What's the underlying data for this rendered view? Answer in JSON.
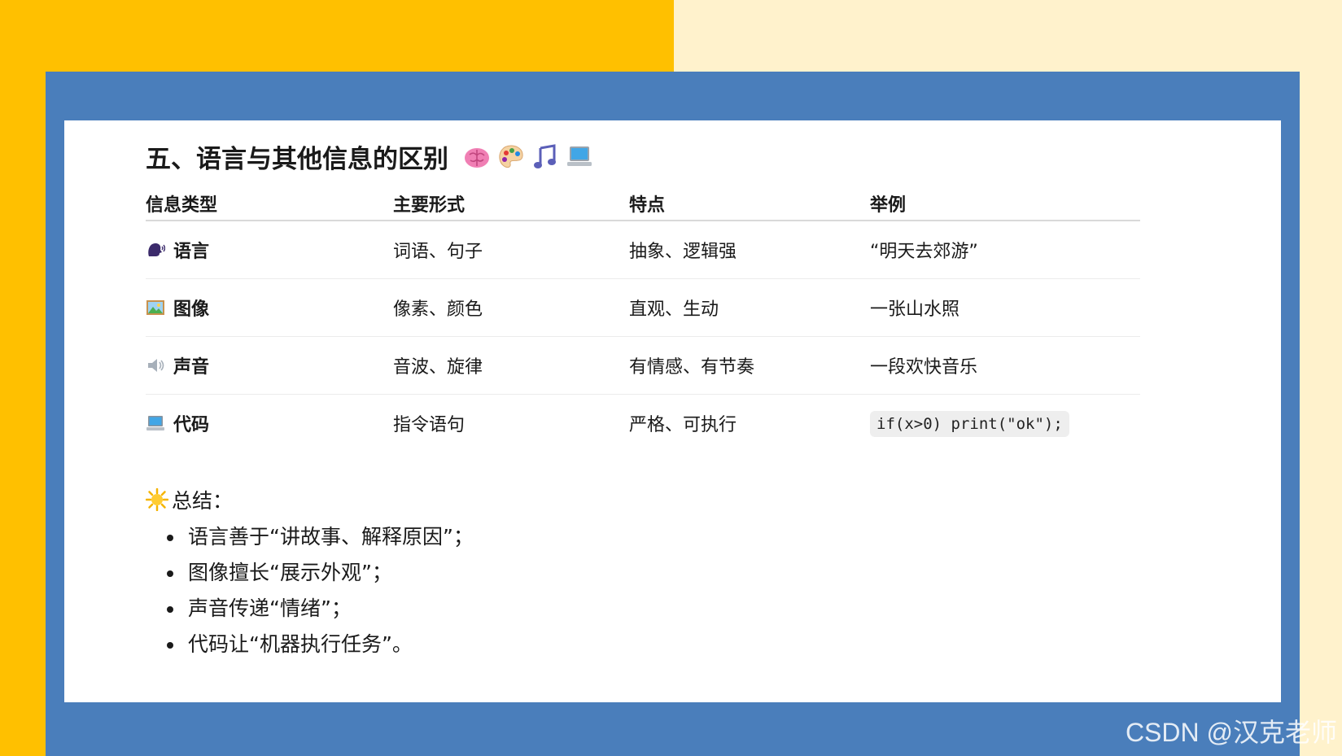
{
  "title": "五、语言与其他信息的区别",
  "title_icons": [
    "brain-icon",
    "palette-icon",
    "music-note-icon",
    "laptop-icon"
  ],
  "table": {
    "headers": [
      "信息类型",
      "主要形式",
      "特点",
      "举例"
    ],
    "rows": [
      {
        "icon": "speaking-head-icon",
        "type": "语言",
        "form": "词语、句子",
        "trait": "抽象、逻辑强",
        "example": "“明天去郊游”"
      },
      {
        "icon": "framed-picture-icon",
        "type": "图像",
        "form": "像素、颜色",
        "trait": "直观、生动",
        "example": "一张山水照"
      },
      {
        "icon": "speaker-icon",
        "type": "声音",
        "form": "音波、旋律",
        "trait": "有情感、有节奏",
        "example": "一段欢快音乐"
      },
      {
        "icon": "computer-icon",
        "type": "代码",
        "form": "指令语句",
        "trait": "严格、可执行",
        "example": "if(x>0) print(\"ok\");"
      }
    ]
  },
  "summary": {
    "icon": "sun-icon",
    "label": "总结：",
    "items": [
      "语言善于“讲故事、解释原因”；",
      "图像擅长“展示外观”；",
      "声音传递“情绪”；",
      "代码让“机器执行任务”。"
    ]
  },
  "watermark": "CSDN @汉克老师",
  "colors": {
    "yellow": "#ffc000",
    "cream": "#fff2cc",
    "blue": "#4a7ebb",
    "card": "#ffffff"
  }
}
